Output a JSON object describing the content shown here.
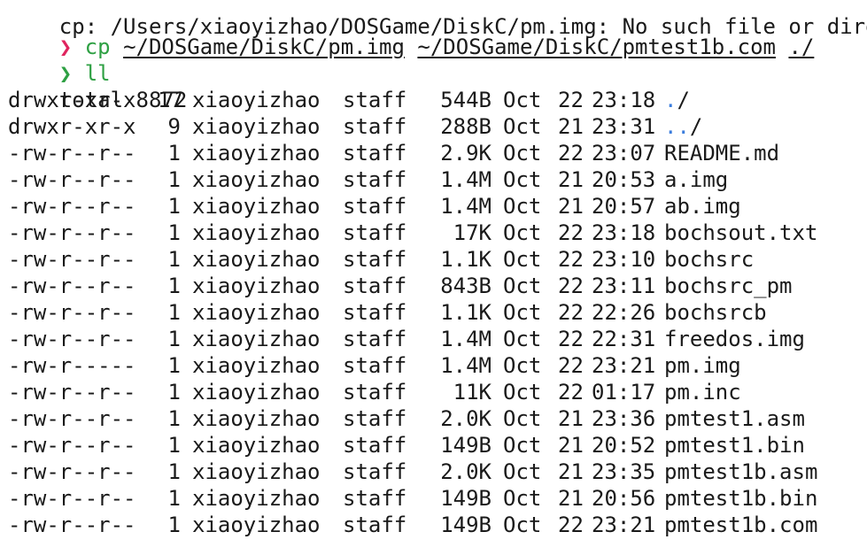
{
  "terminal": {
    "clipped_top_line": "cp: /Users/xiaoyizhao/DOSGame/DiskC/pm.img: No such file or directory",
    "commands": [
      {
        "prompt_symbol": "❯",
        "command": "cp",
        "args": [
          "~/DOSGame/DiskC/pm.img",
          "~/DOSGame/DiskC/pmtest1b.com",
          "./"
        ]
      },
      {
        "prompt_symbol": "❯",
        "command": "ll",
        "args": []
      }
    ],
    "total_line": "total 8872",
    "listing": [
      {
        "perm": "drwxr-xr-x",
        "links": "17",
        "owner": "xiaoyizhao",
        "group": "staff",
        "size": "544B",
        "month": "Oct",
        "day": "22",
        "time": "23:18",
        "name_dots": ".",
        "name": "/"
      },
      {
        "perm": "drwxr-xr-x",
        "links": "9",
        "owner": "xiaoyizhao",
        "group": "staff",
        "size": "288B",
        "month": "Oct",
        "day": "21",
        "time": "23:31",
        "name_dots": "..",
        "name": "/"
      },
      {
        "perm": "-rw-r--r--",
        "links": "1",
        "owner": "xiaoyizhao",
        "group": "staff",
        "size": "2.9K",
        "month": "Oct",
        "day": "22",
        "time": "23:07",
        "name_dots": "",
        "name": "README.md"
      },
      {
        "perm": "-rw-r--r--",
        "links": "1",
        "owner": "xiaoyizhao",
        "group": "staff",
        "size": "1.4M",
        "month": "Oct",
        "day": "21",
        "time": "20:53",
        "name_dots": "",
        "name": "a.img"
      },
      {
        "perm": "-rw-r--r--",
        "links": "1",
        "owner": "xiaoyizhao",
        "group": "staff",
        "size": "1.4M",
        "month": "Oct",
        "day": "21",
        "time": "20:57",
        "name_dots": "",
        "name": "ab.img"
      },
      {
        "perm": "-rw-r--r--",
        "links": "1",
        "owner": "xiaoyizhao",
        "group": "staff",
        "size": "17K",
        "month": "Oct",
        "day": "22",
        "time": "23:18",
        "name_dots": "",
        "name": "bochsout.txt"
      },
      {
        "perm": "-rw-r--r--",
        "links": "1",
        "owner": "xiaoyizhao",
        "group": "staff",
        "size": "1.1K",
        "month": "Oct",
        "day": "22",
        "time": "23:10",
        "name_dots": "",
        "name": "bochsrc"
      },
      {
        "perm": "-rw-r--r--",
        "links": "1",
        "owner": "xiaoyizhao",
        "group": "staff",
        "size": "843B",
        "month": "Oct",
        "day": "22",
        "time": "23:11",
        "name_dots": "",
        "name": "bochsrc_pm"
      },
      {
        "perm": "-rw-r--r--",
        "links": "1",
        "owner": "xiaoyizhao",
        "group": "staff",
        "size": "1.1K",
        "month": "Oct",
        "day": "22",
        "time": "22:26",
        "name_dots": "",
        "name": "bochsrcb"
      },
      {
        "perm": "-rw-r--r--",
        "links": "1",
        "owner": "xiaoyizhao",
        "group": "staff",
        "size": "1.4M",
        "month": "Oct",
        "day": "22",
        "time": "22:31",
        "name_dots": "",
        "name": "freedos.img"
      },
      {
        "perm": "-rw-r-----",
        "links": "1",
        "owner": "xiaoyizhao",
        "group": "staff",
        "size": "1.4M",
        "month": "Oct",
        "day": "22",
        "time": "23:21",
        "name_dots": "",
        "name": "pm.img"
      },
      {
        "perm": "-rw-r--r--",
        "links": "1",
        "owner": "xiaoyizhao",
        "group": "staff",
        "size": "11K",
        "month": "Oct",
        "day": "22",
        "time": "01:17",
        "name_dots": "",
        "name": "pm.inc"
      },
      {
        "perm": "-rw-r--r--",
        "links": "1",
        "owner": "xiaoyizhao",
        "group": "staff",
        "size": "2.0K",
        "month": "Oct",
        "day": "21",
        "time": "23:36",
        "name_dots": "",
        "name": "pmtest1.asm"
      },
      {
        "perm": "-rw-r--r--",
        "links": "1",
        "owner": "xiaoyizhao",
        "group": "staff",
        "size": "149B",
        "month": "Oct",
        "day": "21",
        "time": "20:52",
        "name_dots": "",
        "name": "pmtest1.bin"
      },
      {
        "perm": "-rw-r--r--",
        "links": "1",
        "owner": "xiaoyizhao",
        "group": "staff",
        "size": "2.0K",
        "month": "Oct",
        "day": "21",
        "time": "23:35",
        "name_dots": "",
        "name": "pmtest1b.asm"
      },
      {
        "perm": "-rw-r--r--",
        "links": "1",
        "owner": "xiaoyizhao",
        "group": "staff",
        "size": "149B",
        "month": "Oct",
        "day": "21",
        "time": "20:56",
        "name_dots": "",
        "name": "pmtest1b.bin"
      },
      {
        "perm": "-rw-r--r--",
        "links": "1",
        "owner": "xiaoyizhao",
        "group": "staff",
        "size": "149B",
        "month": "Oct",
        "day": "22",
        "time": "23:21",
        "name_dots": "",
        "name": "pmtest1b.com"
      }
    ],
    "colors": {
      "background": "#ffffff",
      "text": "#1a1a1a",
      "prompt_error": "#e0245e",
      "prompt_ok": "#2ea043",
      "command": "#2ea043",
      "directory_dots": "#3b7ddd"
    }
  }
}
